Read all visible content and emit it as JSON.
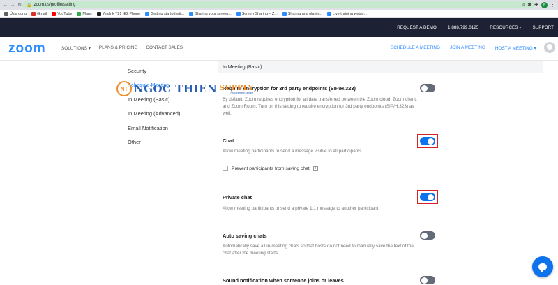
{
  "browser": {
    "url": "zoom.us/profile/setting",
    "avatar_initial": "N",
    "bookmarks": [
      {
        "label": "Ứng dụng",
        "color": "#5f6368"
      },
      {
        "label": "Gmail",
        "color": "#d93025"
      },
      {
        "label": "YouTube",
        "color": "#ff0000"
      },
      {
        "label": "Maps",
        "color": "#34a853"
      },
      {
        "label": "Yealink T21_E2 Phone",
        "color": "#202124"
      },
      {
        "label": "Getting started wit...",
        "color": "#2d8cff"
      },
      {
        "label": "Sharing your screen...",
        "color": "#2d8cff"
      },
      {
        "label": "Screen Sharing – Z...",
        "color": "#2d8cff"
      },
      {
        "label": "Sharing and playin...",
        "color": "#2d8cff"
      },
      {
        "label": "Live training webin...",
        "color": "#2d8cff"
      }
    ]
  },
  "topbar": {
    "request_demo": "REQUEST A DEMO",
    "phone": "1.888.799.0125",
    "resources": "RESOURCES ▾",
    "support": "SUPPORT"
  },
  "header": {
    "logo": "zoom",
    "nav": [
      "SOLUTIONS ▾",
      "PLANS & PRICING",
      "CONTACT SALES"
    ],
    "right_nav": [
      "SCHEDULE A MEETING",
      "JOIN A MEETING",
      "HOST A MEETING ▾"
    ]
  },
  "sidebar": {
    "items": [
      "Security",
      "Schedule Meeting",
      "In Meeting (Basic)",
      "In Meeting (Advanced)",
      "Email Notification",
      "Other"
    ]
  },
  "section": {
    "title": "In Meeting (Basic)"
  },
  "settings": {
    "encryption": {
      "title": "Require encryption for 3rd party endpoints (SIP/H.323)",
      "desc": "By default, Zoom requires encryption for all data transferred between the Zoom cloud, Zoom client, and Zoom Room. Turn on this setting to require encryption for 3rd party endpoints (SIP/H.323) as well.",
      "enabled": false
    },
    "chat": {
      "title": "Chat",
      "desc": "Allow meeting participants to send a message visible to all participants",
      "enabled": true,
      "option": "Prevent participants from saving chat"
    },
    "private_chat": {
      "title": "Private chat",
      "desc": "Allow meeting participants to send a private 1:1 message to another participant.",
      "enabled": true
    },
    "auto_saving": {
      "title": "Auto saving chats",
      "desc": "Automatically save all in-meeting chats so that hosts do not need to manually save the text of the chat after the meeting starts.",
      "enabled": false
    },
    "sound_notification": {
      "title": "Sound notification when someone joins or leaves",
      "enabled": false
    }
  },
  "watermark": {
    "badge": "NT",
    "name": "NGOC THIEN",
    "supply": "SUPPLY",
    "tagline": "Procurement Service"
  },
  "colors": {
    "brand": "#2d8cff",
    "toggle_on": "#0e72ed",
    "toggle_off": "#646b78",
    "highlight": "#d52027"
  }
}
